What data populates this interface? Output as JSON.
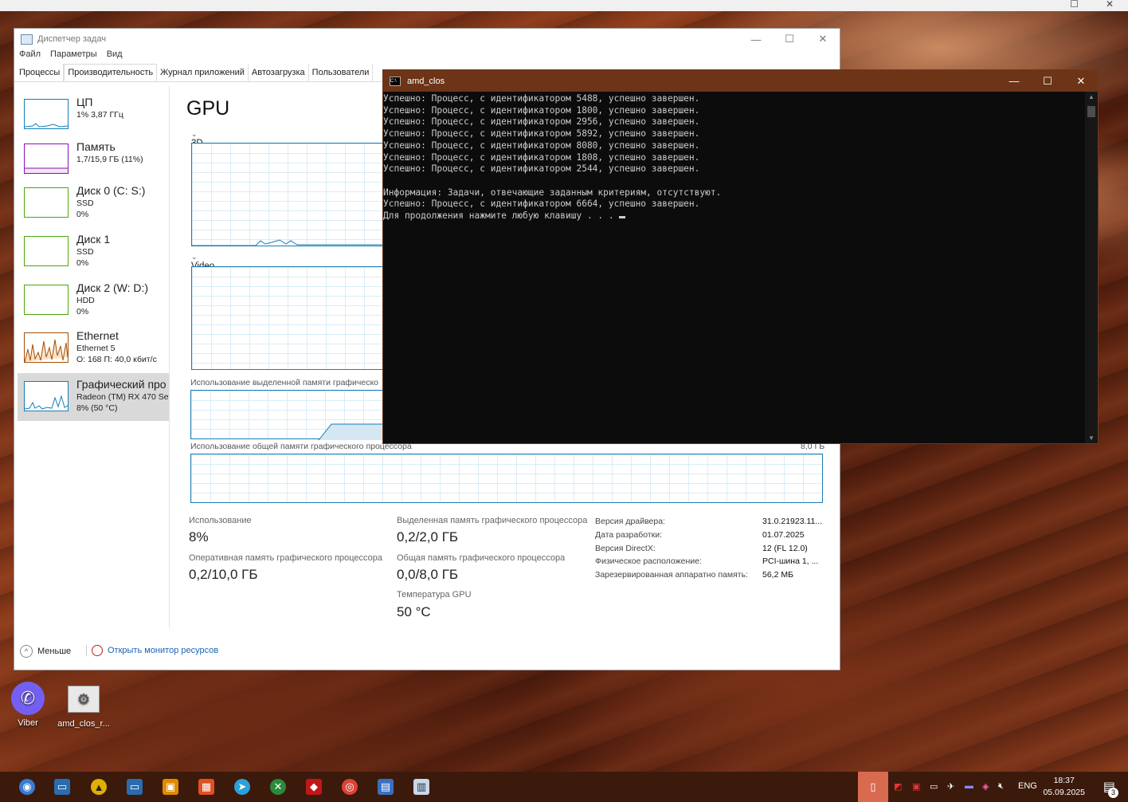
{
  "task_manager": {
    "title": "Диспетчер задач",
    "menu": [
      "Файл",
      "Параметры",
      "Вид"
    ],
    "tabs": [
      "Процессы",
      "Производительность",
      "Журнал приложений",
      "Автозагрузка",
      "Пользователи"
    ],
    "active_tab": "Производительность",
    "sidebar": [
      {
        "name": "ЦП",
        "sub1": "1% 3,87 ГГц",
        "sub2": "",
        "color": "#117dbb"
      },
      {
        "name": "Память",
        "sub1": "1,7/15,9 ГБ (11%)",
        "sub2": "",
        "color": "#8b12ae"
      },
      {
        "name": "Диск 0 (C: S:)",
        "sub1": "SSD",
        "sub2": "0%",
        "color": "#4da60c"
      },
      {
        "name": "Диск 1",
        "sub1": "SSD",
        "sub2": "0%",
        "color": "#4da60c"
      },
      {
        "name": "Диск 2 (W: D:)",
        "sub1": "HDD",
        "sub2": "0%",
        "color": "#4da60c"
      },
      {
        "name": "Ethernet",
        "sub1": "Ethernet 5",
        "sub2": "О: 168 П: 40,0 кбит/с",
        "color": "#a74f01"
      },
      {
        "name": "Графический про",
        "sub1": "Radeon (TM) RX 470 Ser",
        "sub2": "8% (50 °C)",
        "color": "#1a7cb4"
      }
    ],
    "gpu": {
      "title": "GPU",
      "engine_3d": "3D",
      "engine_video_encode": "Video Encode",
      "dedicated_mem_label": "Использование выделенной памяти графическо",
      "shared_mem_label": "Использование общей памяти графического процессора",
      "shared_mem_max": "8,0 ГБ",
      "stats": {
        "utilization_label": "Использование",
        "utilization_value": "8%",
        "dedicated_label": "Выделенная память графического процессора",
        "dedicated_value": "0,2/2,0 ГБ",
        "gpu_memory_label": "Оперативная память графического процессора",
        "gpu_memory_value": "0,2/10,0 ГБ",
        "shared_label": "Общая память графического процессора",
        "shared_value": "0,0/8,0 ГБ",
        "temp_label": "Температура GPU",
        "temp_value": "50 °C"
      },
      "info": [
        {
          "label": "Версия драйвера:",
          "value": "31.0.21923.11..."
        },
        {
          "label": "Дата разработки:",
          "value": "01.07.2025"
        },
        {
          "label": "Версия DirectX:",
          "value": "12 (FL 12.0)"
        },
        {
          "label": "Физическое расположение:",
          "value": "PCI-шина 1, ..."
        },
        {
          "label": "Зарезервированная аппаратно память:",
          "value": "56,2 МБ"
        }
      ]
    },
    "footer": {
      "fewer": "Меньше",
      "resmon": "Открыть монитор ресурсов"
    }
  },
  "console": {
    "title": "amd_clos",
    "lines": [
      "Успешно: Процесс, с идентификатором 5488, успешно завершен.",
      "Успешно: Процесс, с идентификатором 1800, успешно завершен.",
      "Успешно: Процесс, с идентификатором 2956, успешно завершен.",
      "Успешно: Процесс, с идентификатором 5892, успешно завершен.",
      "Успешно: Процесс, с идентификатором 8080, успешно завершен.",
      "Успешно: Процесс, с идентификатором 1808, успешно завершен.",
      "Успешно: Процесс, с идентификатором 2544, успешно завершен.",
      "",
      "Информация: Задачи, отвечающие заданным критериям, отсутствуют.",
      "Успешно: Процесс, с идентификатором 6664, успешно завершен.",
      "Для продолжения нажмите любую клавишу . . . "
    ]
  },
  "desktop_icons": [
    {
      "label": "Viber",
      "icon": "viber-icon"
    },
    {
      "label": "amd_clos_r...",
      "icon": "batch-file-icon"
    }
  ],
  "taskbar": {
    "language": "ENG",
    "time": "18:37",
    "date": "05.09.2025",
    "notification_count": "3"
  }
}
